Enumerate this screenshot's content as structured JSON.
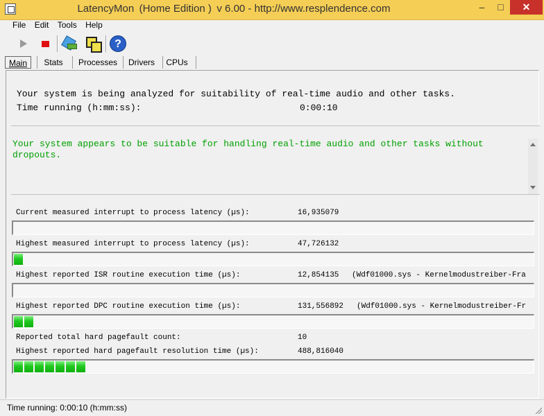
{
  "window": {
    "title": "LatencyMon (Home Edition ) v 6.00 - http://www.resplendence.com",
    "min_label": "–",
    "max_label": "□",
    "close_label": "✕"
  },
  "menu": {
    "items": [
      {
        "label": "File"
      },
      {
        "label": "Edit"
      },
      {
        "label": "Tools"
      },
      {
        "label": "Help"
      }
    ]
  },
  "toolbar": {
    "icons": [
      "play-icon",
      "stop-icon",
      "tool-icon",
      "windows-icon",
      "help-icon"
    ],
    "help_glyph": "?"
  },
  "tabs": [
    {
      "label": "Main",
      "active": true
    },
    {
      "label": "Stats",
      "active": false
    },
    {
      "label": "Processes",
      "active": false
    },
    {
      "label": "Drivers",
      "active": false
    },
    {
      "label": "CPUs",
      "active": false
    }
  ],
  "main": {
    "analysis_line": "Your system is being analyzed for suitability of real-time audio and other tasks.",
    "time_running_label": "Time running (h:mm:ss):",
    "time_running_value": "0:00:10",
    "result_message": "Your system appears to be suitable for handling real-time audio and other tasks without dropouts.",
    "result_color": "#00a000",
    "metrics": [
      {
        "label": "Current measured interrupt to process latency (µs):",
        "value": "16,935079",
        "driver": "",
        "bar_segments": 0
      },
      {
        "label": "Highest measured interrupt to process latency (µs):",
        "value": "47,726132",
        "driver": "",
        "bar_segments": 1
      },
      {
        "label": "Highest reported ISR routine execution time (µs):",
        "value": "12,854135",
        "driver": "(Wdf01000.sys - Kernelmodustreiber-Fra",
        "bar_segments": 0
      },
      {
        "label": "Highest reported DPC routine execution time (µs):",
        "value": "131,556892",
        "driver": "(Wdf01000.sys - Kernelmodustreiber-Fr",
        "bar_segments": 2
      },
      {
        "label": "Reported total hard pagefault count:",
        "value": "10",
        "driver": "",
        "bar_segments": null
      },
      {
        "label": "Highest reported hard pagefault resolution time (µs):",
        "value": "488,816040",
        "driver": "",
        "bar_segments": 7
      }
    ]
  },
  "status": {
    "text": "Time running: 0:00:10  (h:mm:ss)"
  }
}
